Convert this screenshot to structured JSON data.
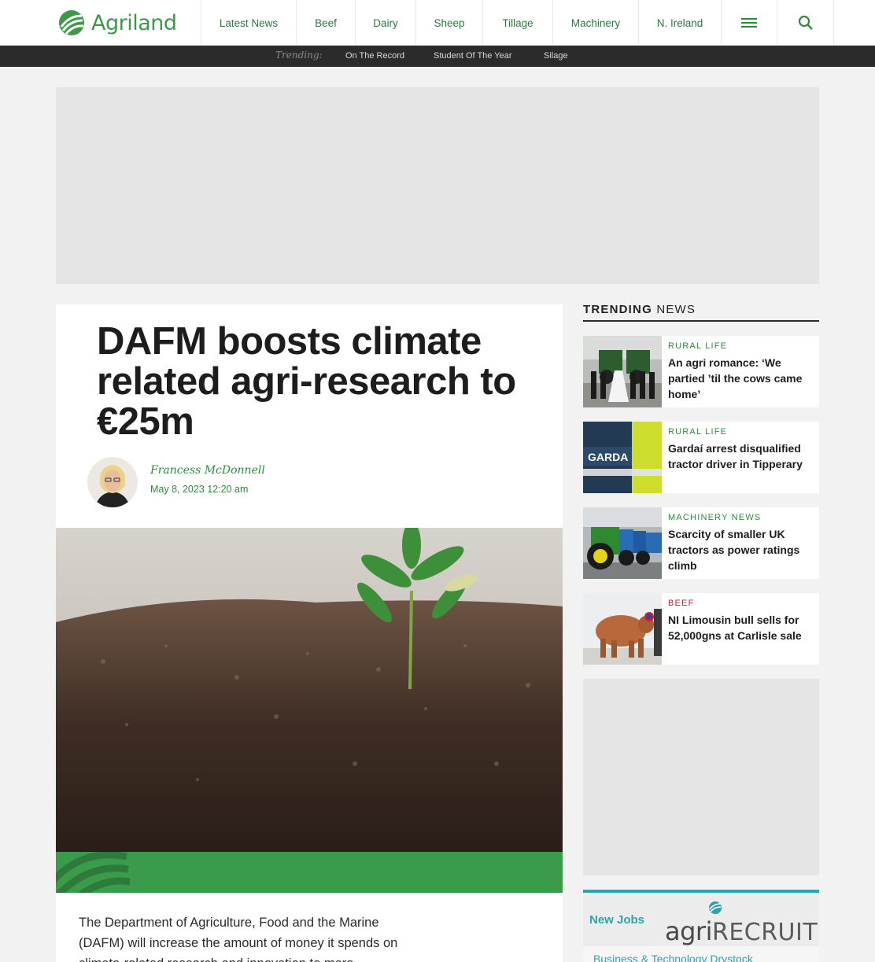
{
  "header": {
    "logo_text": "Agriland",
    "nav": [
      "Latest News",
      "Beef",
      "Dairy",
      "Sheep",
      "Tillage",
      "Machinery",
      "N. Ireland"
    ]
  },
  "trending_bar": {
    "label": "Trending:",
    "links": [
      "On The Record",
      "Student Of The Year",
      "Silage"
    ]
  },
  "article": {
    "headline": "DAFM boosts climate related agri-research to €25m",
    "author": "Francess McDonnell",
    "date": "May 8, 2023 12:20 am",
    "body": "The Department of Agriculture, Food and the Marine (DAFM) will increase the amount of money it spends on climate-related research and innovation to more"
  },
  "sidebar": {
    "heading_bold": "TRENDING",
    "heading_rest": "NEWS",
    "cards": [
      {
        "category": "RURAL LIFE",
        "title": "An agri romance: ‘We partied ’til the cows came home’",
        "category_color": "#2e8b3e"
      },
      {
        "category": "RURAL LIFE",
        "title": "Gardaí arrest disqualified tractor driver in Tipperary",
        "category_color": "#2e8b3e"
      },
      {
        "category": "MACHINERY NEWS",
        "title": "Scarcity of smaller UK tractors as power ratings climb",
        "category_color": "#2e8b3e"
      },
      {
        "category": "BEEF",
        "title": "NI Limousin bull sells for 52,000gns at Carlisle sale",
        "category_color": "#b3263a"
      }
    ],
    "jobs": {
      "title": "New Jobs",
      "logo_agri": "agri",
      "logo_recruit": "RECRUIT",
      "first_link": "Business & Technology Drystock"
    }
  },
  "colors": {
    "brand_green": "#3c9a47",
    "link_green": "#2e8b3e",
    "trend_bar": "#2b2b2b",
    "jobs_teal": "#2fa3ad"
  }
}
